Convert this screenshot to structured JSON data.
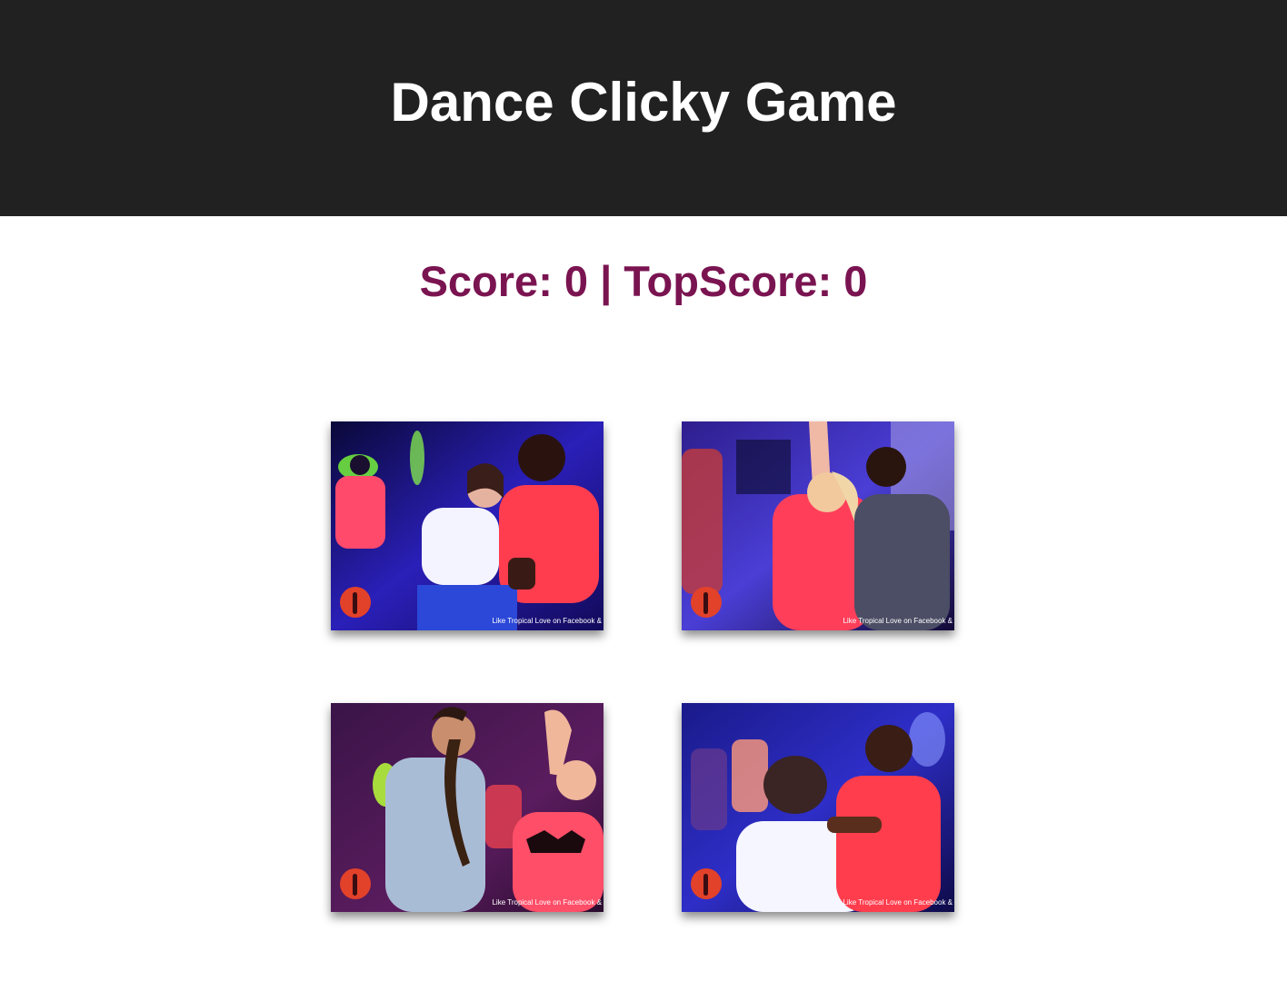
{
  "header": {
    "title": "Dance Clicky Game"
  },
  "scoreboard": {
    "text": "Score: 0 | TopScore: 0"
  },
  "cards": [
    {
      "name": "dance-photo-1",
      "caption": "Like Tropical Love on Facebook &"
    },
    {
      "name": "dance-photo-2",
      "caption": "Like Tropical Love on Facebook &"
    },
    {
      "name": "dance-photo-3",
      "caption": "Like Tropical Love on Facebook &"
    },
    {
      "name": "dance-photo-4",
      "caption": "Like Tropical Love on Facebook &"
    }
  ],
  "colors": {
    "header_bg": "#212121",
    "score_text": "#7a1451"
  }
}
